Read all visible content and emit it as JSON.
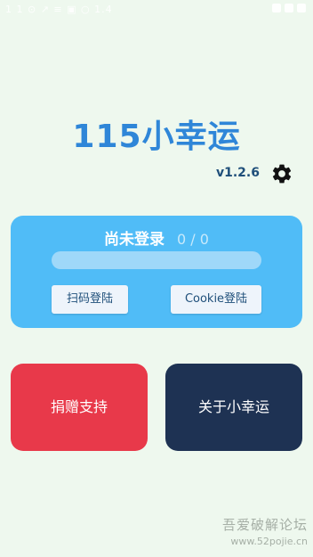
{
  "status_bar": {
    "left_text": "1 1 ⊙ ↗ ≡ ▣ ○ 1.4"
  },
  "app": {
    "title": "115小幸运",
    "version": "v1.2.6"
  },
  "login_card": {
    "status": "尚未登录",
    "count": "0 / 0",
    "progress": 0,
    "scan_login_label": "扫码登陆",
    "cookie_login_label": "Cookie登陆"
  },
  "actions": {
    "donate_label": "捐赠支持",
    "about_label": "关于小幸运"
  },
  "watermark": {
    "title": "吾爱破解论坛",
    "url": "www.52pojie.cn"
  },
  "colors": {
    "background": "#eef8ee",
    "title": "#2f86d8",
    "card": "#50bcf7",
    "donate": "#e8394a",
    "about": "#1e3253"
  }
}
